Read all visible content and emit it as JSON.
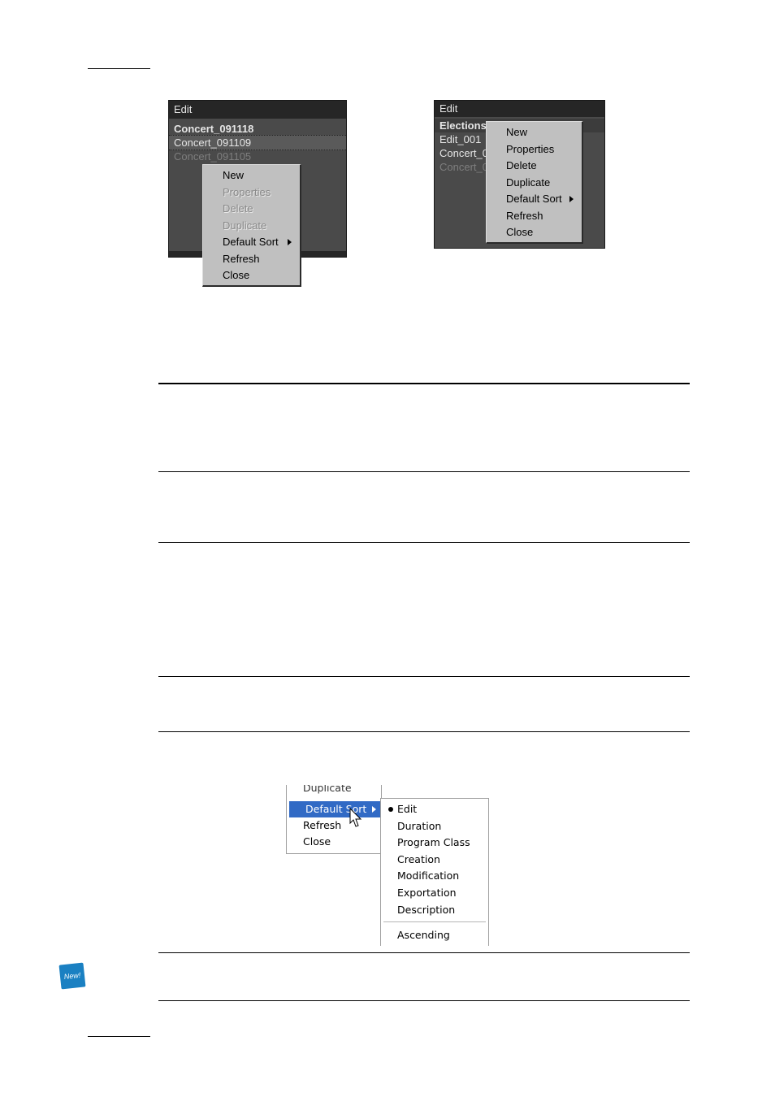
{
  "screenshot_left": {
    "header": "Edit",
    "rows": [
      "Concert_091118",
      "Concert_091109",
      "Concert_091105"
    ],
    "menu": [
      "New",
      "Properties",
      "Delete",
      "Duplicate",
      "Default Sort",
      "Refresh",
      "Close"
    ]
  },
  "screenshot_right": {
    "header": "Edit",
    "rows": [
      "Elections",
      "Edit_001",
      "Concert_0",
      "Concert_0"
    ],
    "menu": [
      "New",
      "Properties",
      "Delete",
      "Duplicate",
      "Default Sort",
      "Refresh",
      "Close"
    ]
  },
  "sort_figure": {
    "main_menu": [
      "Duplicate",
      "Default Sort",
      "Refresh",
      "Close"
    ],
    "submenu": [
      "Edit",
      "Duration",
      "Program Class",
      "Creation",
      "Modification",
      "Exportation",
      "Description"
    ],
    "order": "Ascending",
    "selected": "Edit"
  },
  "badge": "New!"
}
